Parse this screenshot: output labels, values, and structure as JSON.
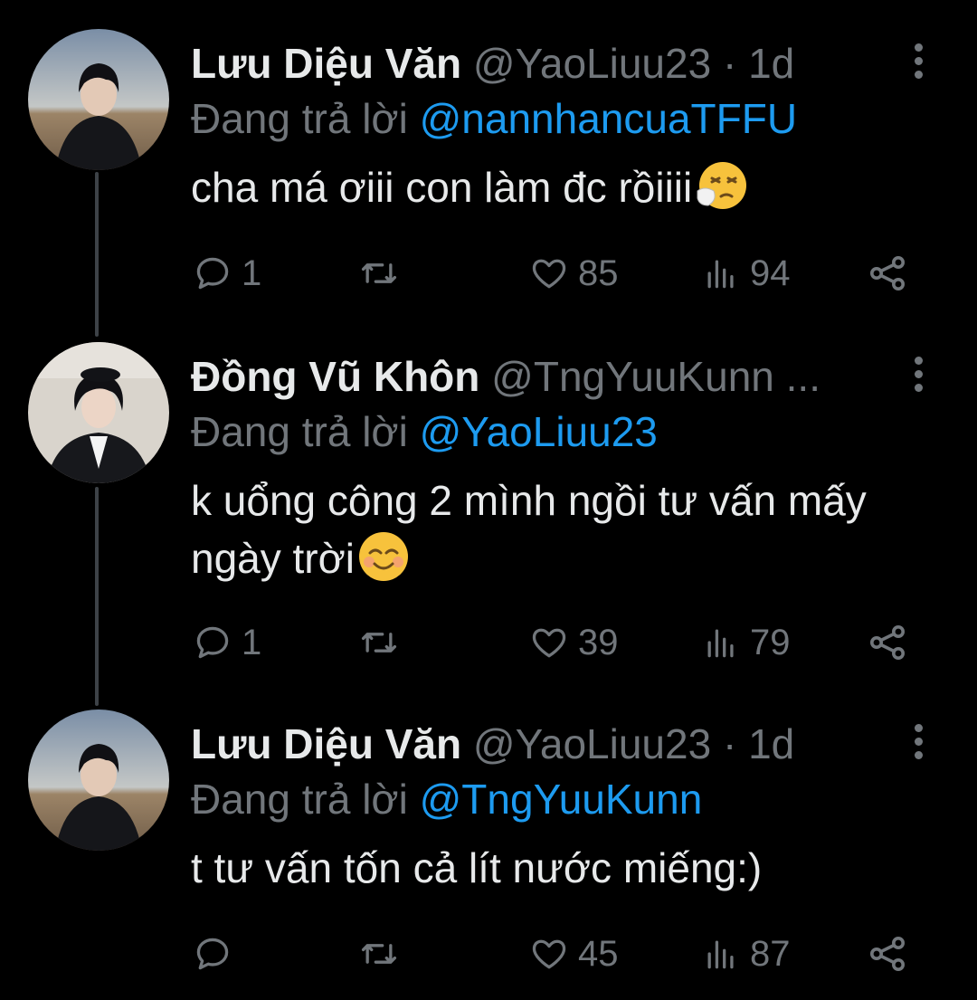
{
  "colors": {
    "background": "#000000",
    "text_primary": "#e7e9ea",
    "text_secondary": "#71767b",
    "link": "#1d9bf0",
    "thread_line": "#3d4247"
  },
  "tweets": [
    {
      "author_name": "Lưu Diệu Văn",
      "handle": "@YaoLiuu23",
      "separator": "·",
      "time": "1d",
      "replying_prefix": "Đang trả lời",
      "replying_to": "@nannhancuaTFFU",
      "text": "cha má ơiii con làm đc rồiiii",
      "emoji": "sneezing-face",
      "stats": {
        "replies": "1",
        "retweets": "",
        "likes": "85",
        "views": "94"
      }
    },
    {
      "author_name": "Đồng Vũ Khôn",
      "handle": "@TngYuuKunn",
      "separator": "...",
      "time": "",
      "replying_prefix": "Đang trả lời",
      "replying_to": "@YaoLiuu23",
      "text": "k uổng công 2 mình ngồi tư vấn mấy ngày trời",
      "emoji": "smiling-face",
      "stats": {
        "replies": "1",
        "retweets": "",
        "likes": "39",
        "views": "79"
      }
    },
    {
      "author_name": "Lưu Diệu Văn",
      "handle": "@YaoLiuu23",
      "separator": "·",
      "time": "1d",
      "replying_prefix": "Đang trả lời",
      "replying_to": "@TngYuuKunn",
      "text": "t tư vấn tốn cả lít nước miếng:)",
      "emoji": "",
      "stats": {
        "replies": "",
        "retweets": "",
        "likes": "45",
        "views": "87"
      }
    }
  ],
  "icons": {
    "reply": "reply-icon",
    "retweet": "retweet-icon",
    "like": "heart-icon",
    "views": "views-icon",
    "share": "share-icon",
    "more": "more-vertical-icon"
  }
}
